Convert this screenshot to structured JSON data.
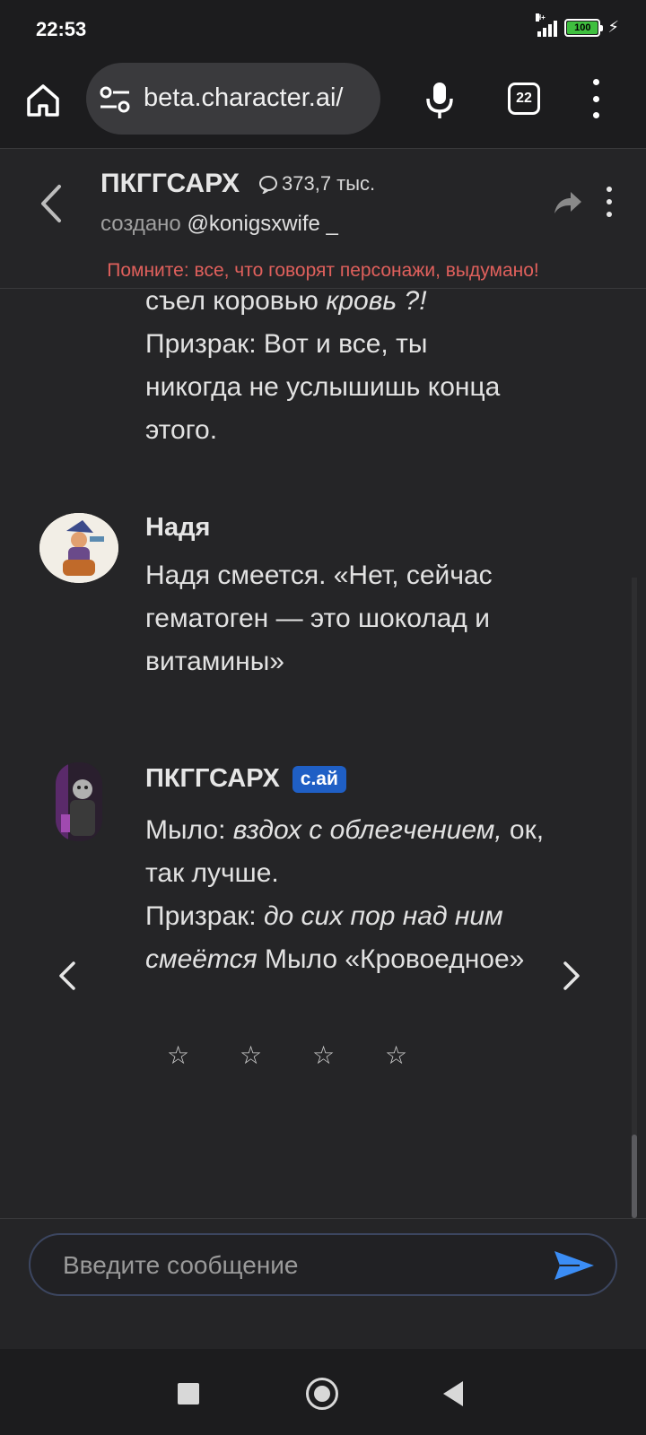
{
  "status_bar": {
    "time": "22:53",
    "network": "H+",
    "battery": "100",
    "charging_icon": "bolt-icon"
  },
  "browser": {
    "url": "beta.character.ai/",
    "tab_count": "22"
  },
  "chat_header": {
    "character_name": "ПКГГСАРХ",
    "chat_count": "373,7 тыс.",
    "creator_prefix": "создано",
    "creator_handle": "@konigsxwife _",
    "disclaimer": "Помните: все, что говорят персонажи, выдумано!"
  },
  "messages": {
    "previous_tail": {
      "line1_plain": "съел коровью ",
      "line1_italic": "кровь ?!",
      "rest": "Призрак: Вот и все, ты никогда не услышишь конца этого."
    },
    "user_message": {
      "name": "Надя",
      "text": "Надя смеется. «Нет, сейчас гематоген — это шоколад и витамины»"
    },
    "bot_message": {
      "name": "ПКГГСАРХ",
      "badge": "с.ай",
      "line1_plain": "Мыло: ",
      "line1_italic": "вздох с облегчением,",
      "line1_tail": " ок, так лучше.",
      "line2_plain": "Призрак: ",
      "line2_italic": "до сих пор над ним смеётся",
      "line2_tail": " Мыло «Кровоедное»"
    },
    "rating": {
      "star_glyph": "☆",
      "max": 4,
      "value": 0
    }
  },
  "input": {
    "placeholder": "Введите сообщение"
  },
  "colors": {
    "background": "#252527",
    "disclaimer": "#e0605c",
    "badge": "#1f5fc5",
    "send": "#3b8df5"
  }
}
